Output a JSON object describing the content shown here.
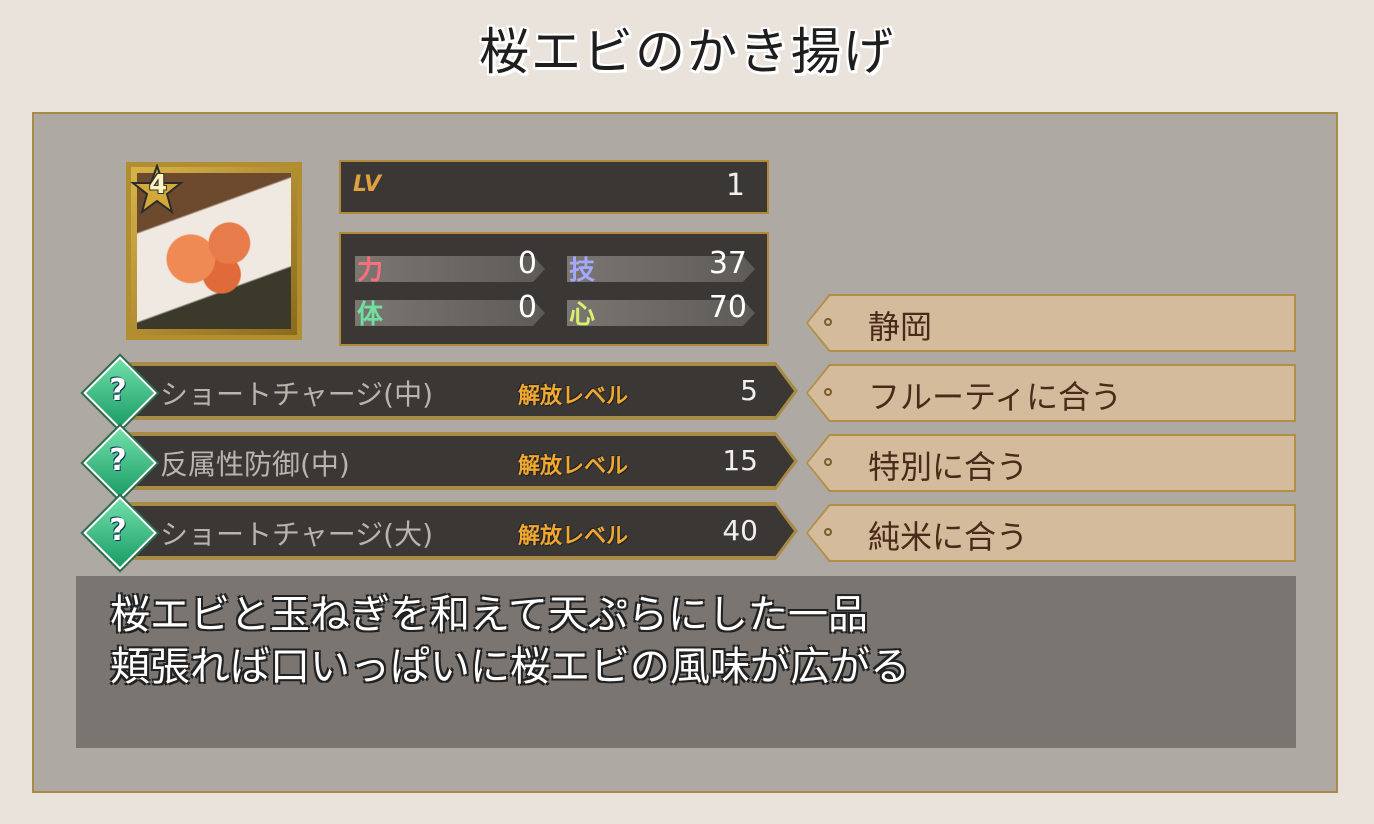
{
  "title": "桜エビのかき揚げ",
  "item": {
    "rarity": "4",
    "icon": "sakura-shrimp-kakiage-image"
  },
  "level": {
    "label": "LV",
    "value": "1"
  },
  "stats": [
    {
      "label": "力",
      "value": "0",
      "color": "#ff6f7a"
    },
    {
      "label": "技",
      "value": "37",
      "color": "#a4a8ff"
    },
    {
      "label": "体",
      "value": "0",
      "color": "#6fe0a0"
    },
    {
      "label": "心",
      "value": "70",
      "color": "#d8f070"
    }
  ],
  "skills": [
    {
      "name": "ショートチャージ(中)",
      "release_label": "解放レベル",
      "level": "5"
    },
    {
      "name": "反属性防御(中)",
      "release_label": "解放レベル",
      "level": "15"
    },
    {
      "name": "ショートチャージ(大)",
      "release_label": "解放レベル",
      "level": "40"
    }
  ],
  "skill_icon": "?",
  "tags": [
    "静岡",
    "フルーティに合う",
    "特別に合う",
    "純米に合う"
  ],
  "description": [
    "桜エビと玉ねぎを和えて天ぷらにした一品",
    "頬張れば口いっぱいに桜エビの風味が広がる"
  ]
}
